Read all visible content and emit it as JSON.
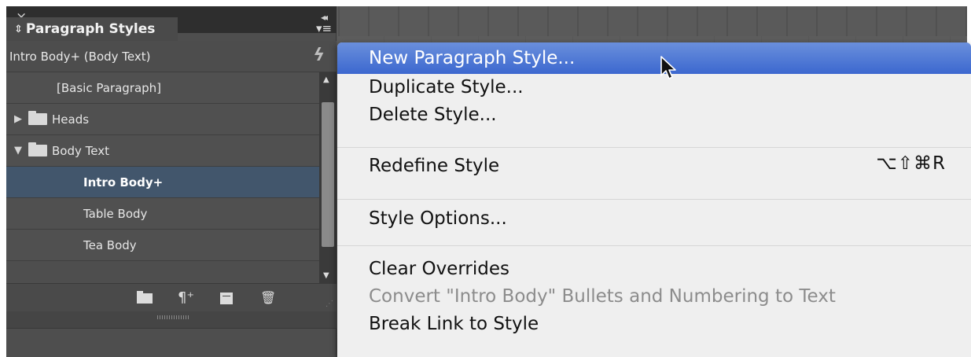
{
  "panel": {
    "close_glyph": "×",
    "collapse_glyph": "◂◂",
    "tab_arrows": "⇕",
    "tab_label": "Paragraph Styles",
    "menu_glyph": "▾≡",
    "current_style": "Intro Body+ (Body Text)",
    "lightning_glyph": "ϟ",
    "styles": [
      {
        "label": "[Basic Paragraph]",
        "kind": "style",
        "indent": 1,
        "selected": false
      },
      {
        "label": "Heads",
        "kind": "folder",
        "expanded": false,
        "selected": false
      },
      {
        "label": "Body Text",
        "kind": "folder",
        "expanded": true,
        "selected": false
      },
      {
        "label": "Intro Body+",
        "kind": "style",
        "indent": 2,
        "selected": true
      },
      {
        "label": "Table Body",
        "kind": "style",
        "indent": 2,
        "selected": false
      },
      {
        "label": "Tea Body",
        "kind": "style",
        "indent": 2,
        "selected": false
      }
    ],
    "footer_icons": [
      "folder-icon",
      "clear-overrides-icon",
      "new-style-icon",
      "trash-icon"
    ],
    "clear_overrides_glyph": "¶⁺",
    "trash_glyph": "🗑",
    "grip_glyph": "⋰"
  },
  "menu": {
    "items": [
      {
        "label": "New Paragraph Style...",
        "highlight": true
      },
      {
        "label": "Duplicate Style..."
      },
      {
        "label": "Delete Style..."
      },
      {
        "label": "Redefine Style",
        "shortcut": "⌥⇧⌘R"
      },
      {
        "label": "Style Options..."
      },
      {
        "label": "Clear Overrides"
      },
      {
        "label": "Convert \"Intro Body\" Bullets and Numbering to Text",
        "disabled": true
      },
      {
        "label": "Break Link to Style"
      }
    ]
  },
  "colors": {
    "menu_highlight": "#3c68cf",
    "selected_row": "#42566c",
    "panel_bg": "#4e4e4e"
  }
}
